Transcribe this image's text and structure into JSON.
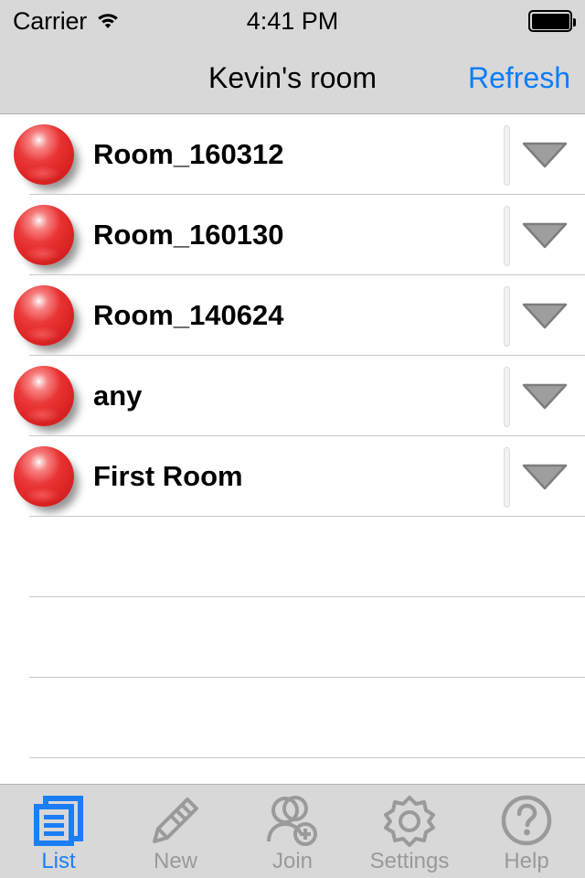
{
  "status_bar": {
    "carrier": "Carrier",
    "wifi_icon": "wifi-icon",
    "time": "4:41 PM",
    "battery_icon": "battery-full-icon"
  },
  "nav_bar": {
    "title": "Kevin's room",
    "action_label": "Refresh",
    "action_color": "#0b7cfb"
  },
  "list": {
    "rows": [
      {
        "label": "Room_160312",
        "status_icon": "red-sphere-icon",
        "disclosure_icon": "triangle-down-icon"
      },
      {
        "label": "Room_160130",
        "status_icon": "red-sphere-icon",
        "disclosure_icon": "triangle-down-icon"
      },
      {
        "label": "Room_140624",
        "status_icon": "red-sphere-icon",
        "disclosure_icon": "triangle-down-icon"
      },
      {
        "label": "any",
        "status_icon": "red-sphere-icon",
        "disclosure_icon": "triangle-down-icon"
      },
      {
        "label": "First Room",
        "status_icon": "red-sphere-icon",
        "disclosure_icon": "triangle-down-icon"
      }
    ],
    "empty_rows": 4,
    "separator_color": "#c8c8c8",
    "ball_color": "#e12f2f"
  },
  "tab_bar": {
    "active_color": "#1b7ef5",
    "inactive_color": "#9a9a9a",
    "tabs": [
      {
        "label": "List",
        "icon": "documents-icon",
        "active": true
      },
      {
        "label": "New",
        "icon": "pencil-icon",
        "active": false
      },
      {
        "label": "Join",
        "icon": "person-add-icon",
        "active": false
      },
      {
        "label": "Settings",
        "icon": "gear-icon",
        "active": false
      },
      {
        "label": "Help",
        "icon": "question-circle-icon",
        "active": false
      }
    ]
  }
}
